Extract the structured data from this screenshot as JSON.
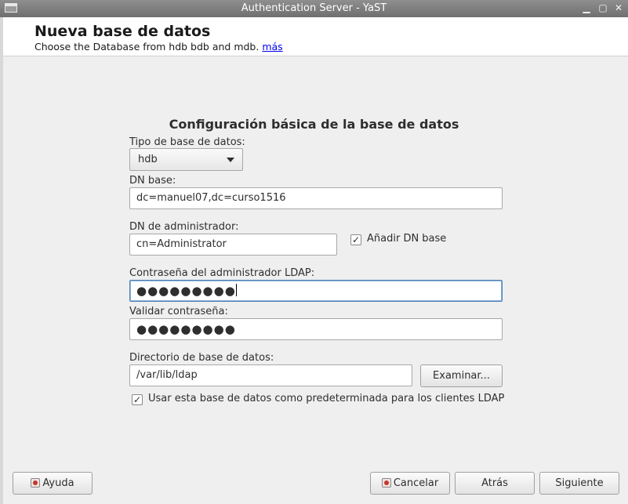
{
  "window": {
    "title": "Authentication Server - YaST",
    "icon": "window-icon"
  },
  "header": {
    "title": "Nueva base de datos",
    "subtitle": "Choose the Database from hdb bdb and mdb.",
    "more_link": "más"
  },
  "form": {
    "section_title": "Configuración básica de la base de datos",
    "db_type": {
      "label": "Tipo de base de datos:",
      "value": "hdb"
    },
    "base_dn": {
      "label": "DN base:",
      "value": "dc=manuel07,dc=curso1516"
    },
    "admin_dn": {
      "label": "DN de administrador:",
      "value": "cn=Administrator"
    },
    "append_base_dn": {
      "label": "Añadir DN base",
      "checked": true
    },
    "ldap_password": {
      "label": "Contraseña del administrador LDAP:",
      "value": "●●●●●●●●●"
    },
    "validate_password": {
      "label": "Validar contraseña:",
      "value": "●●●●●●●●●"
    },
    "db_directory": {
      "label": "Directorio de base de datos:",
      "value": "/var/lib/ldap"
    },
    "browse_button": "Examinar...",
    "default_db": {
      "label": "Usar esta base de datos como predeterminada para los clientes LDAP",
      "checked": true
    }
  },
  "footer": {
    "help": "Ayuda",
    "cancel": "Cancelar",
    "back": "Atrás",
    "next": "Siguiente"
  }
}
